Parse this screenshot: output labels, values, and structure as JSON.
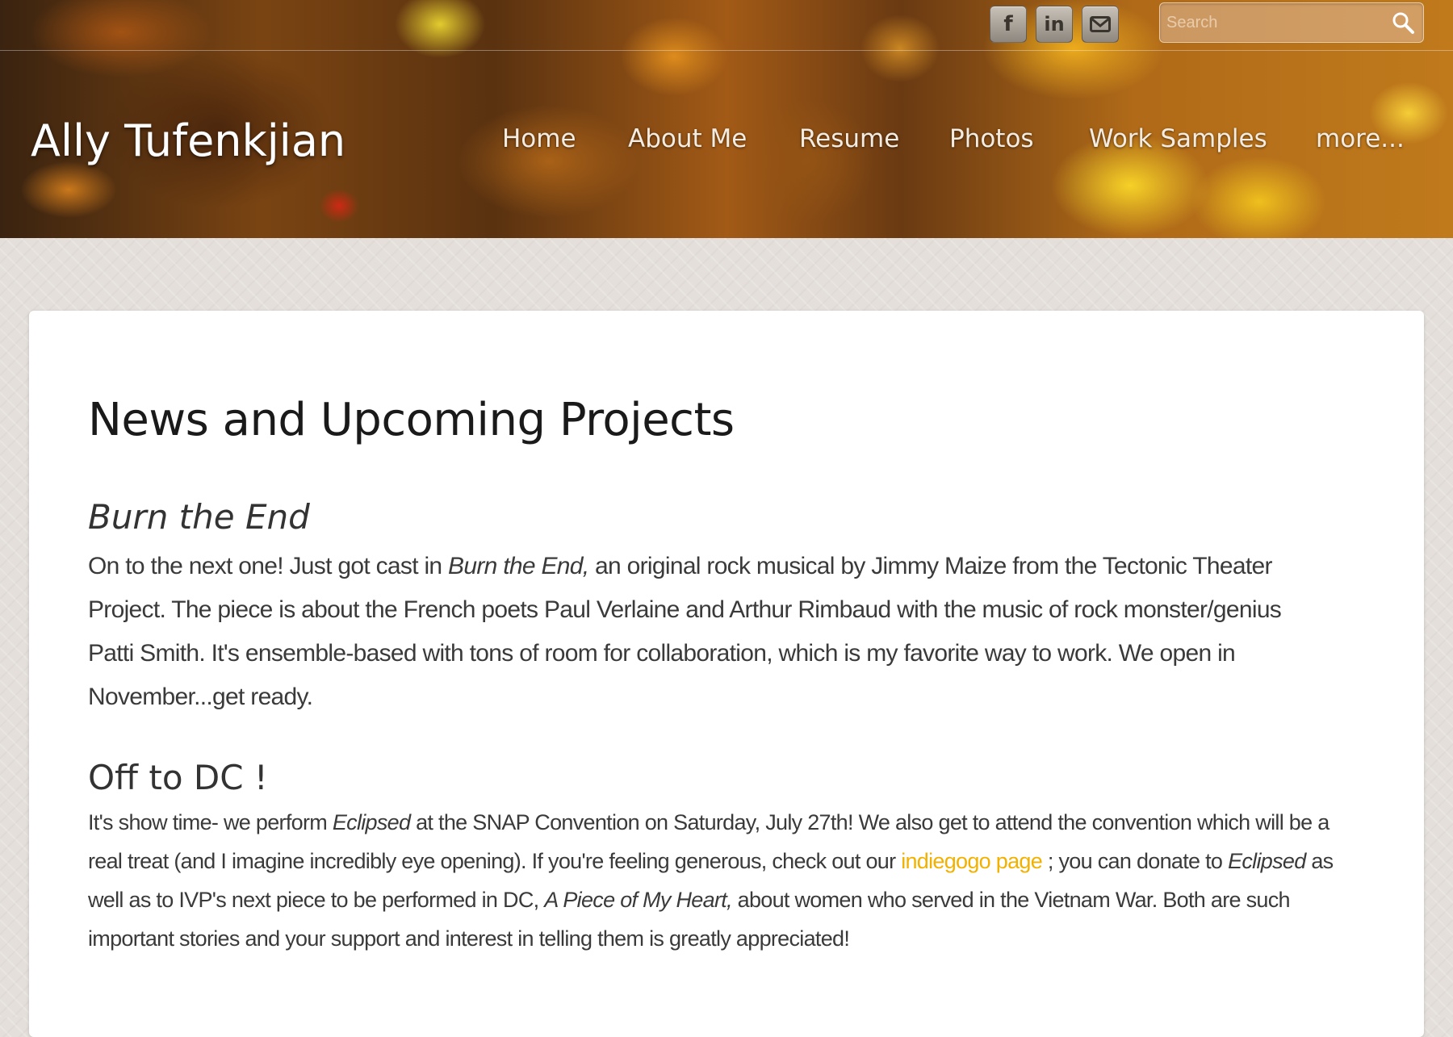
{
  "header": {
    "site_title": "Ally Tufenkjian",
    "social": [
      {
        "label": "f",
        "icon": "facebook-icon"
      },
      {
        "label": "in",
        "icon": "linkedin-icon"
      },
      {
        "label": "",
        "icon": "email-icon"
      }
    ],
    "search": {
      "placeholder": "Search",
      "value": ""
    },
    "nav": [
      {
        "label": "Home"
      },
      {
        "label": "About Me"
      },
      {
        "label": "Resume"
      },
      {
        "label": "Photos"
      },
      {
        "label": "Work Samples"
      },
      {
        "label": "more..."
      }
    ]
  },
  "content": {
    "page_title": "News and Upcoming Projects",
    "section1": {
      "heading": "Burn the End",
      "line1_a": "On to the next one!  Just got cast in ",
      "line1_italic": "Burn the End,",
      "line1_b": " an original rock musical by Jimmy Maize from the Tectonic Theater",
      "line2": "Project.  The piece is about the French poets Paul Verlaine and Arthur Rimbaud with the music of rock monster/genius",
      "line3": "Patti Smith.  It's ensemble-based with tons of room for collaboration, which is my favorite way to work.  We open in",
      "line4": "November...get ready."
    },
    "section2": {
      "heading": "Off to DC !",
      "line1_a": "It's show time-  we perform ",
      "line1_italic": "Eclipsed",
      "line1_b": " at the SNAP Convention on Saturday, July 27th!   We also get to attend the convention which will be a",
      "line2_a": "real treat (and I imagine incredibly eye opening).  If you're feeling generous, check out our ",
      "link_text": "indiegogo page",
      "line2_b": " ; you can donate to ",
      "line2_italic": "Eclipsed",
      "line2_c": " as",
      "line3_a": "well as to IVP's next piece to be performed in DC, ",
      "line3_italic": "A Piece of My Heart,",
      "line3_b": " about women who served in the Vietnam War.  Both are such",
      "line4": "important stories and your support and interest in telling them is greatly appreciated!"
    }
  },
  "colors": {
    "link": "#f2b100",
    "text": "#3a3a3a",
    "heading": "#1a1a1a",
    "card_bg": "#ffffff",
    "page_bg": "#e4dfdb"
  }
}
